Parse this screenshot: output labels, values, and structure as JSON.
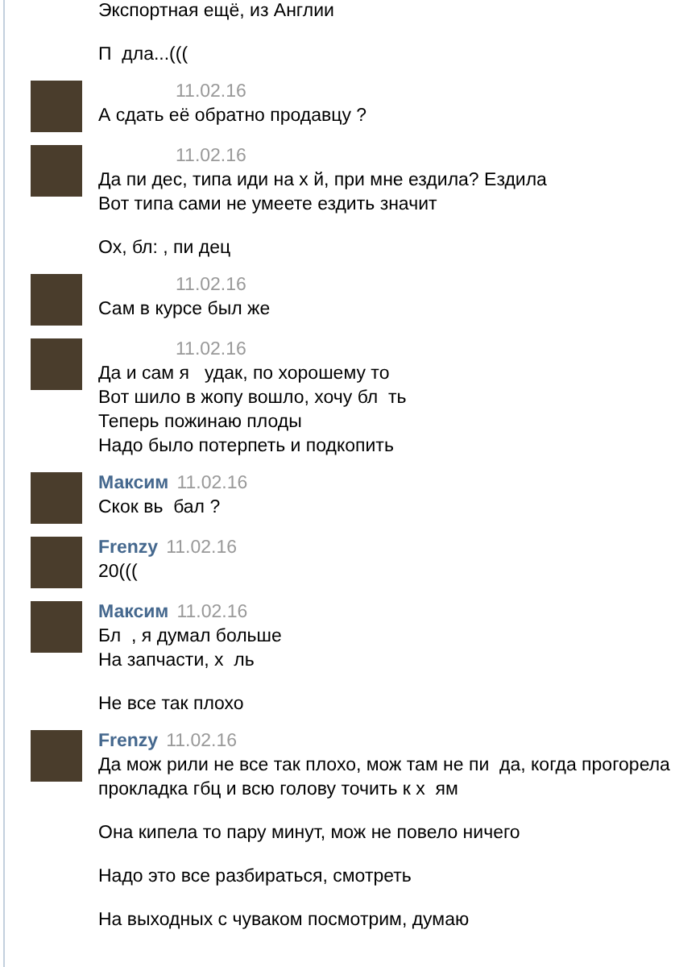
{
  "groups": [
    {
      "avatar": false,
      "messages": [
        [
          "Экспортная ещё, из Англии"
        ],
        [
          "П  дла...((("
        ]
      ]
    },
    {
      "avatar": true,
      "date": "11.02.16",
      "messages": [
        [
          "А сдать её обратно продавцу ?"
        ]
      ]
    },
    {
      "avatar": true,
      "date": "11.02.16",
      "messages": [
        [
          "Да пи деc, типа иди на х й, при мне ездила? Ездила",
          "Вот типа сами не умеете ездить значит"
        ],
        [
          "Ох, бл: , пи дец"
        ]
      ]
    },
    {
      "avatar": true,
      "date": "11.02.16",
      "messages": [
        [
          "Сам в курсе был же"
        ]
      ]
    },
    {
      "avatar": true,
      "date": "11.02.16",
      "messages": [
        [
          "Да и сам я   удак, по хорошему то",
          "Вот шило в жопу вошло, хочу бл  ть",
          "Теперь пожинаю плоды",
          "Надо было потерпеть и подкопить"
        ]
      ]
    },
    {
      "avatar": true,
      "name": "Максим",
      "date": "11.02.16",
      "messages": [
        [
          "Скок вь  бал ?"
        ]
      ]
    },
    {
      "avatar": true,
      "name": "Frenzy",
      "date": "11.02.16",
      "messages": [
        [
          "20((("
        ]
      ]
    },
    {
      "avatar": true,
      "name": "Максим",
      "date": "11.02.16",
      "messages": [
        [
          "Бл  , я думал больше",
          "На запчасти, х  ль"
        ],
        [
          "Не все так плохо"
        ]
      ]
    },
    {
      "avatar": true,
      "name": "Frenzy",
      "date": "11.02.16",
      "messages": [
        [
          "Да мож рили не все так плохо, мож там не пи  да, когда прогорела",
          "прокладка гбц и всю голову точить к х  ям"
        ],
        [
          "Она кипела то пару минут, мож не повело ничего"
        ],
        [
          "Надо это все разбираться, смотреть"
        ],
        [
          "На выходных с чуваком посмотрим, думаю"
        ]
      ]
    }
  ]
}
